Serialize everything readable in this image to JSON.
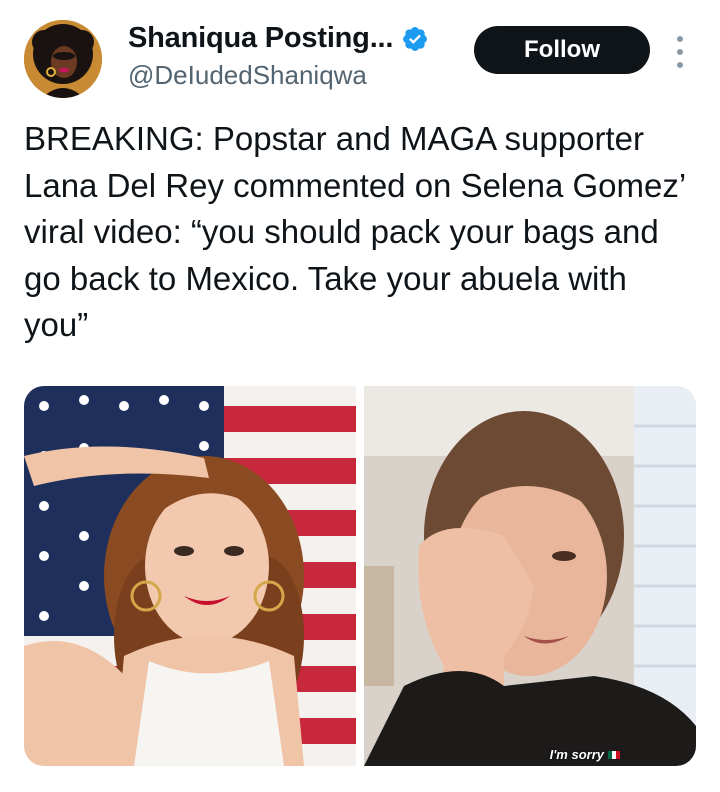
{
  "author": {
    "display_name": "Shaniqua Posting...",
    "handle": "@DeIudedShaniqwa",
    "verified_icon": "verified-badge-icon",
    "avatar_icon": "avatar-illustration"
  },
  "actions": {
    "follow_label": "Follow",
    "more_icon": "more-options-icon"
  },
  "tweet": {
    "text": "BREAKING: Popstar and MAGA supporter Lana Del Rey commented on Selena Gomez’ viral video: “you should pack your bags and go back to Mexico. Take your abuela with you”"
  },
  "media": {
    "items": [
      {
        "kind": "photo",
        "caption": ""
      },
      {
        "kind": "video-still",
        "caption": "I'm sorry"
      }
    ]
  },
  "colors": {
    "text": "#0f1419",
    "muted": "#536471",
    "verified": "#1d9bf0",
    "follow_bg": "#0f1419"
  }
}
